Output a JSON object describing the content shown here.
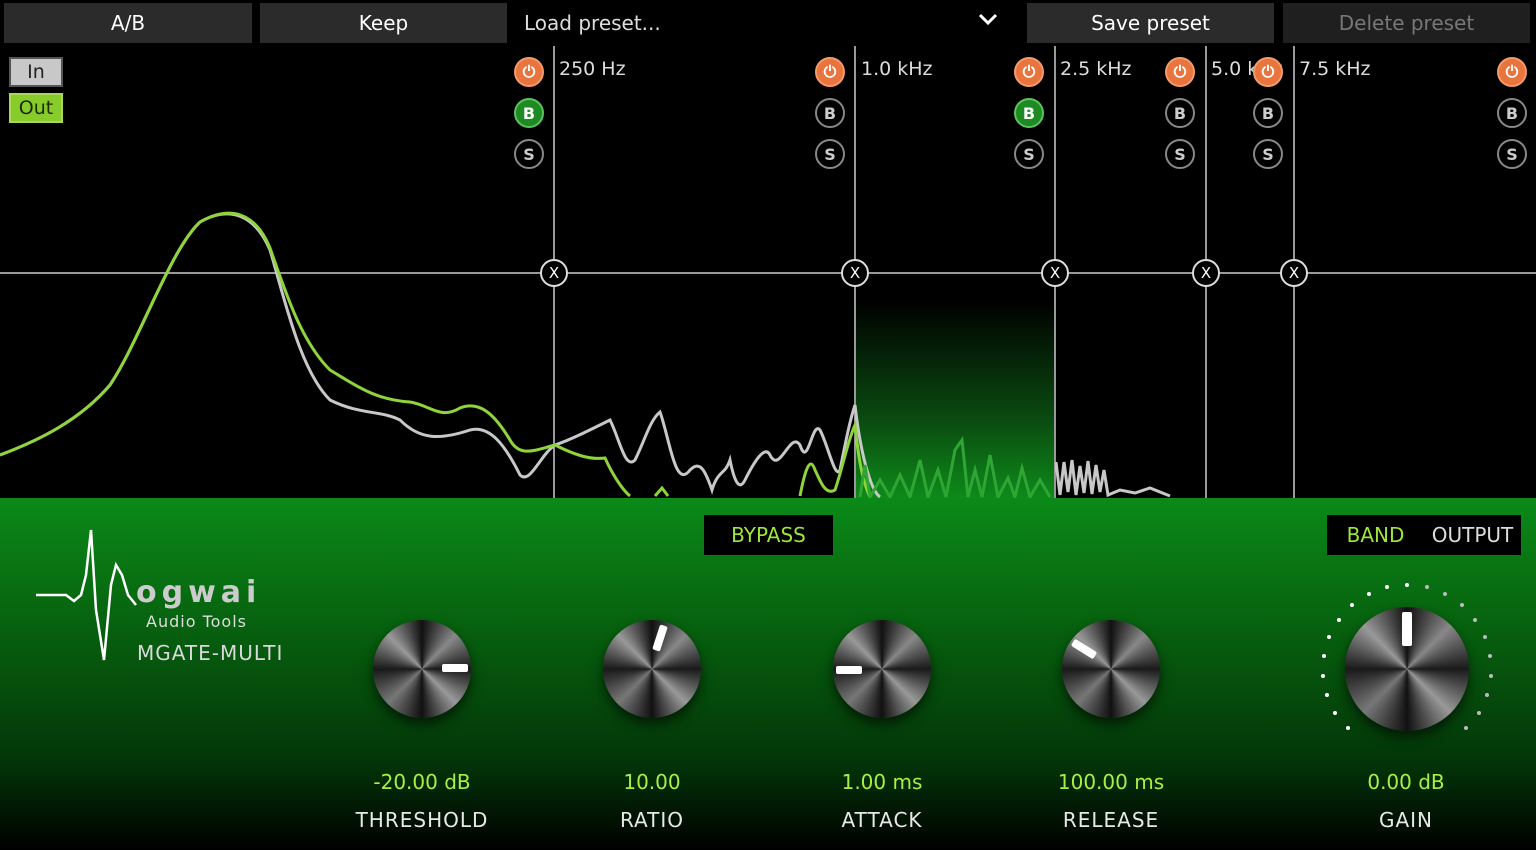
{
  "topbar": {
    "ab_label": "A/B",
    "keep_label": "Keep",
    "preset_placeholder": "Load preset...",
    "save_label": "Save preset",
    "delete_label": "Delete preset"
  },
  "meter_toggle": {
    "in_label": "In",
    "out_label": "Out",
    "selected": "Out"
  },
  "bands": [
    {
      "freq": "250 Hz",
      "power_on": true,
      "bypass_on": true
    },
    {
      "freq": "1.0 kHz",
      "power_on": true,
      "bypass_on": false
    },
    {
      "freq": "2.5 kHz",
      "power_on": true,
      "bypass_on": true
    },
    {
      "freq": "5.0 kHz",
      "power_on": true,
      "bypass_on": false
    },
    {
      "freq": "7.5 kHz",
      "power_on": true,
      "bypass_on": false
    },
    {
      "freq": "",
      "power_on": true,
      "bypass_on": false
    }
  ],
  "band_button_labels": {
    "bypass": "B",
    "solo": "S",
    "crossover": "X"
  },
  "colors": {
    "accent": "#9ee63a",
    "power": "#e8743e",
    "bypass_active": "#1e8a24",
    "panel": "#0b8a18"
  },
  "icons": {
    "power": "power-icon",
    "dropdown": "chevron-down-icon",
    "remove": "close-icon"
  },
  "logo": {
    "name": "ogwai",
    "subtitle": "Audio Tools",
    "product": "MGATE-MULTI"
  },
  "bypass_label": "BYPASS",
  "view_toggle": {
    "band_label": "BAND",
    "output_label": "OUTPUT",
    "active": "BAND"
  },
  "knobs": {
    "threshold": {
      "value": "-20.00 dB",
      "label": "THRESHOLD"
    },
    "ratio": {
      "value": "10.00",
      "label": "RATIO"
    },
    "attack": {
      "value": "1.00 ms",
      "label": "ATTACK"
    },
    "release": {
      "value": "100.00 ms",
      "label": "RELEASE"
    },
    "gain": {
      "value": "0.00 dB",
      "label": "GAIN"
    }
  }
}
